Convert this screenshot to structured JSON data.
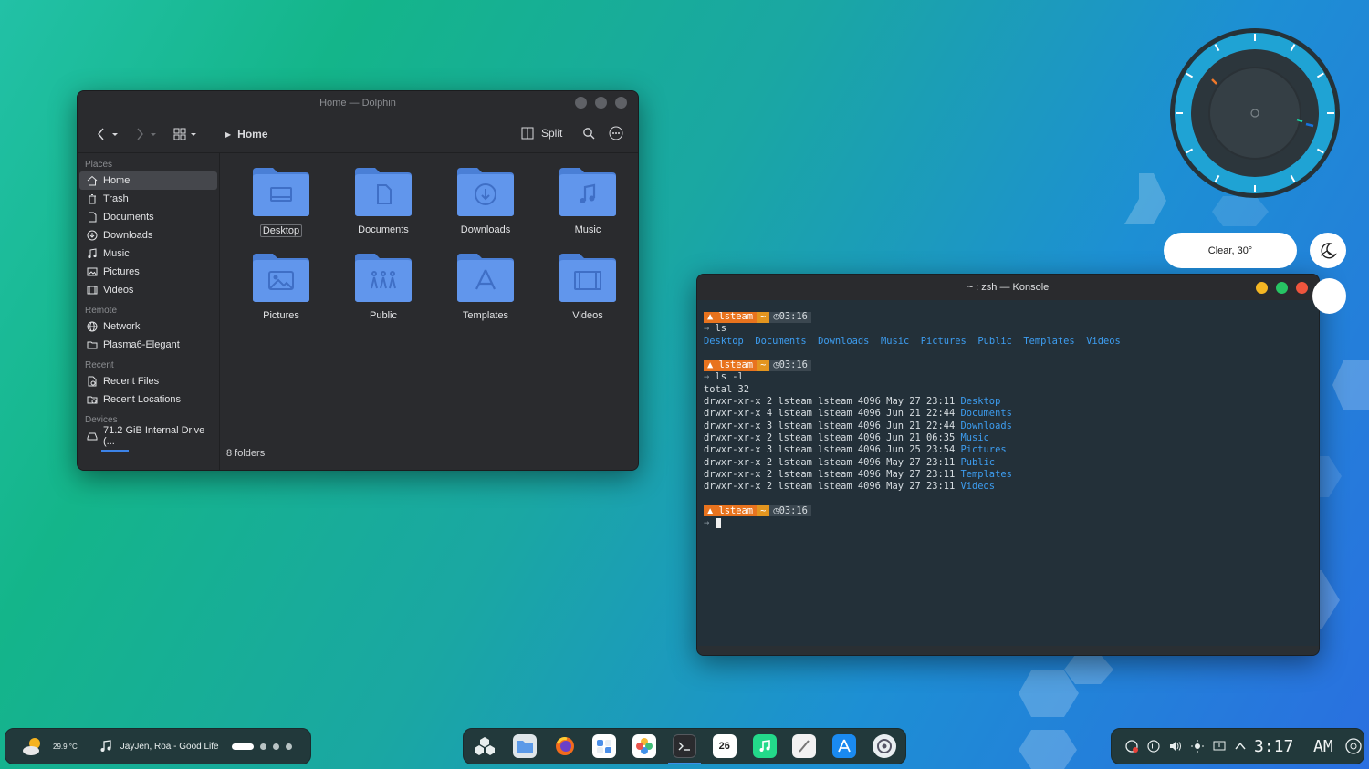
{
  "dolphin": {
    "title": "Home — Dolphin",
    "toolbar": {
      "breadcrumb": "Home",
      "split_label": "Split"
    },
    "sidebar": {
      "sections": [
        {
          "name": "Places",
          "items": [
            "Home",
            "Trash",
            "Documents",
            "Downloads",
            "Music",
            "Pictures",
            "Videos"
          ]
        },
        {
          "name": "Remote",
          "items": [
            "Network",
            "Plasma6-Elegant"
          ]
        },
        {
          "name": "Recent",
          "items": [
            "Recent Files",
            "Recent Locations"
          ]
        },
        {
          "name": "Devices",
          "items": [
            "71.2 GiB Internal Drive (..."
          ]
        }
      ]
    },
    "folders": [
      "Desktop",
      "Documents",
      "Downloads",
      "Music",
      "Pictures",
      "Public",
      "Templates",
      "Videos"
    ],
    "status": "8 folders"
  },
  "konsole": {
    "title": "~ : zsh — Konsole",
    "prompt_user": "lsteam",
    "prompt_dir": "~",
    "prompt_time": "03:16",
    "cmd1": "ls",
    "ls_output": [
      "Desktop",
      "Documents",
      "Downloads",
      "Music",
      "Pictures",
      "Public",
      "Templates",
      "Videos"
    ],
    "cmd2": "ls -l",
    "total": "total 32",
    "rows": [
      {
        "meta": "drwxr-xr-x 2 lsteam lsteam 4096 May 27 23:11",
        "name": "Desktop"
      },
      {
        "meta": "drwxr-xr-x 4 lsteam lsteam 4096 Jun 21 22:44",
        "name": "Documents"
      },
      {
        "meta": "drwxr-xr-x 3 lsteam lsteam 4096 Jun 21 22:44",
        "name": "Downloads"
      },
      {
        "meta": "drwxr-xr-x 2 lsteam lsteam 4096 Jun 21 06:35",
        "name": "Music"
      },
      {
        "meta": "drwxr-xr-x 3 lsteam lsteam 4096 Jun 25 23:54",
        "name": "Pictures"
      },
      {
        "meta": "drwxr-xr-x 2 lsteam lsteam 4096 May 27 23:11",
        "name": "Public"
      },
      {
        "meta": "drwxr-xr-x 2 lsteam lsteam 4096 May 27 23:11",
        "name": "Templates"
      },
      {
        "meta": "drwxr-xr-x 2 lsteam lsteam 4096 May 27 23:11",
        "name": "Videos"
      }
    ]
  },
  "widgets": {
    "weather_pill": "Clear, 30°"
  },
  "panel": {
    "temperature": "29.9 °C",
    "now_playing": "JayJen, Roa - Good Life",
    "clock": "3:17  AM",
    "calendar_day": "26",
    "dock_icons": [
      "plasma-icon",
      "files-icon",
      "firefox-icon",
      "store-icon",
      "photos-icon",
      "terminal-icon",
      "calendar-icon",
      "music-icon",
      "notes-icon",
      "appstore-icon",
      "settings-icon"
    ]
  },
  "colors": {
    "accent": "#3c83e8",
    "folder": "#5b8fe6",
    "prompt_orange": "#e8731e",
    "ls_blue": "#3d9df0"
  }
}
